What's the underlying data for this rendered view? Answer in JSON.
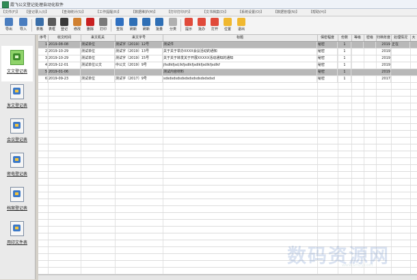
{
  "window": {
    "title": "霞飞公文登记处理自动化软件"
  },
  "menu": [
    {
      "label": "【文件(F)】"
    },
    {
      "label": "【登记录入(I)】"
    },
    {
      "label": "【查询统计(S)】"
    },
    {
      "label": "【工作提醒(R)】"
    },
    {
      "label": "【数据维护(M)】"
    },
    {
      "label": "【打印打印(P)】"
    },
    {
      "label": "【文书档案(D)】"
    },
    {
      "label": "【系统设置(O)】"
    },
    {
      "label": "【数据管理(N)】"
    },
    {
      "label": "【帮助(H)】"
    }
  ],
  "toolbar": [
    {
      "label": "导出",
      "icon": "export-icon",
      "color": "#4a7dbf"
    },
    {
      "label": "导入",
      "icon": "import-icon",
      "color": "#4a7dbf"
    },
    {
      "label": "表格",
      "icon": "table-icon",
      "color": "#3a6ea8"
    },
    {
      "label": "表框",
      "icon": "frame-icon",
      "color": "#5a5a5a"
    },
    {
      "label": "登记",
      "icon": "register-icon",
      "color": "#3a3a3a"
    },
    {
      "label": "修改",
      "icon": "edit-icon",
      "color": "#d08030"
    },
    {
      "label": "删除",
      "icon": "delete-icon",
      "color": "#c82020"
    },
    {
      "label": "打印",
      "icon": "print-icon",
      "color": "#7a7a7a"
    },
    {
      "label": "查找",
      "icon": "find-icon",
      "color": "#3070c0"
    },
    {
      "label": "刷新",
      "icon": "refresh-icon",
      "color": "#2f6fb5"
    },
    {
      "label": "刷新",
      "icon": "refresh-icon",
      "color": "#2f6fb5"
    },
    {
      "label": "批量",
      "icon": "batch-icon",
      "color": "#2f6fb5"
    },
    {
      "label": "分类",
      "icon": "category-icon",
      "color": "#b0b0b0"
    },
    {
      "label": "提示",
      "icon": "alert-icon",
      "color": "#e04a3a"
    },
    {
      "label": "批办",
      "icon": "approve-icon",
      "color": "#e04a3a"
    },
    {
      "label": "打开",
      "icon": "open-icon",
      "color": "#e04a3a"
    },
    {
      "label": "位置",
      "icon": "location-icon",
      "color": "#f0b830"
    },
    {
      "label": "退出",
      "icon": "exit-icon",
      "color": "#f0b830"
    }
  ],
  "nav": [
    {
      "label": "文文登记表",
      "active": true
    },
    {
      "label": "发文登记表"
    },
    {
      "label": "会议登记表"
    },
    {
      "label": "密电登记表"
    },
    {
      "label": "档案登记表"
    },
    {
      "label": "用印文件表"
    }
  ],
  "grid": {
    "columns": [
      "序号",
      "收文时间",
      "来文机关",
      "来文字号",
      "标题",
      "保密程度",
      "份数",
      "等级",
      "密级",
      "归档年度",
      "处理情况",
      "大"
    ],
    "rows": [
      {
        "no": "1",
        "date": "2019-08-08",
        "org": "测试单位",
        "ref": "测试字〔2019〕12号",
        "title": "测试件",
        "secret": "秘密",
        "copies": "1",
        "level": "",
        "grade": "",
        "year": "2019",
        "status": "正在",
        "x": ""
      },
      {
        "no": "2",
        "date": "2019-10-29",
        "org": "测试单位",
        "ref": "测试字〔2019〕13号",
        "title": "关于关于举办XXXX会议活动的通知",
        "secret": "秘密",
        "copies": "1",
        "level": "",
        "grade": "",
        "year": "2019",
        "status": "",
        "x": ""
      },
      {
        "no": "3",
        "date": "2019-10-29",
        "org": "测试单位",
        "ref": "测试字〔2019〕15号",
        "title": "关于关于转发关于开展XXXXX活动通知的通知",
        "secret": "秘密",
        "copies": "1",
        "level": "",
        "grade": "",
        "year": "2019",
        "status": "",
        "x": ""
      },
      {
        "no": "4",
        "date": "2019-12-01",
        "org": "测试单位公文",
        "ref": "中公文〔2019〕9号",
        "title": "jfsdlkfjsd;lkfjsdlkfjsdlkfjsdlkfjsdlkf",
        "secret": "秘密",
        "copies": "1",
        "level": "",
        "grade": "",
        "year": "2019",
        "status": "",
        "x": ""
      },
      {
        "no": "5",
        "date": "2019-01-06",
        "org": "",
        "ref": "",
        "title": "测试内容材料",
        "secret": "秘密",
        "copies": "1",
        "level": "",
        "grade": "",
        "year": "2019",
        "status": "",
        "x": ""
      },
      {
        "no": "6",
        "date": "2019-09-23",
        "org": "测试单位",
        "ref": "测试字〔2017〕9号",
        "title": "sdsdsdsdsdsdsdsdsdsdsdsdsd",
        "secret": "秘密",
        "copies": "1",
        "level": "",
        "grade": "",
        "year": "2017",
        "status": "",
        "x": ""
      }
    ]
  },
  "watermark": {
    "main": "数码资源网",
    "url": "www.smzy.com"
  }
}
